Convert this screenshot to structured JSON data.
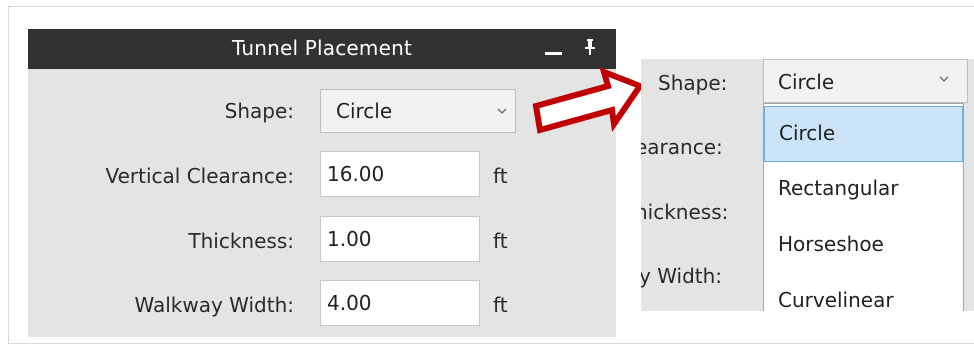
{
  "panel": {
    "title": "Tunnel Placement",
    "fields": {
      "shape": {
        "label": "Shape:",
        "value": "Circle"
      },
      "vertical_clearance": {
        "label": "Vertical Clearance:",
        "value": "16.00",
        "unit": "ft"
      },
      "thickness": {
        "label": "Thickness:",
        "value": "1.00",
        "unit": "ft"
      },
      "walkway_width": {
        "label": "Walkway Width:",
        "value": "4.00",
        "unit": "ft"
      }
    }
  },
  "expanded": {
    "shape_label": "Shape:",
    "shape_value": "Circle",
    "partial_labels": [
      "earance:",
      "nickness:",
      "y Width:"
    ],
    "options": [
      "Circle",
      "Rectangular",
      "Horseshoe",
      "Curvelinear"
    ],
    "selected_option": "Circle"
  },
  "colors": {
    "title_bar": "#323232",
    "panel_bg": "#e4e4e4",
    "arrow": "#c00000",
    "selected_highlight": "#cce4f7"
  },
  "icons": [
    "minimize-icon",
    "pin-icon",
    "chevron-down-icon",
    "arrow-right-icon"
  ]
}
